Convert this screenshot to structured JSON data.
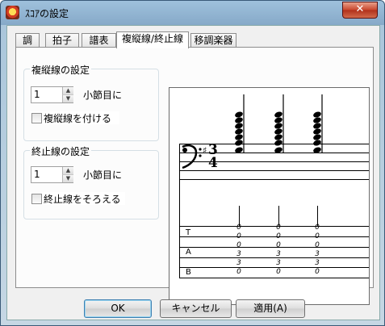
{
  "window": {
    "title": "ｽｺｱの設定",
    "close_glyph": "✕"
  },
  "tabs": [
    {
      "label": "調"
    },
    {
      "label": "拍子"
    },
    {
      "label": "譜表"
    },
    {
      "label": "複縦線/終止線",
      "active": true
    },
    {
      "label": "移調楽器"
    }
  ],
  "double_bar": {
    "group_title": "複縦線の設定",
    "measure_value": "1",
    "measure_label": "小節目に",
    "checkbox_label": "複縦線を付ける",
    "checked": false
  },
  "final_bar": {
    "group_title": "終止線の設定",
    "measure_value": "1",
    "measure_label": "小節目に",
    "checkbox_label": "終止線をそろえる",
    "checked": false
  },
  "preview": {
    "clef": "bass-clef",
    "key_signature": "♯",
    "time_signature_top": "3",
    "time_signature_bottom": "4",
    "tab_letters": [
      "T",
      "A",
      "B"
    ],
    "tab_fret_columns": [
      [
        "0",
        "0",
        "0",
        "3",
        "3",
        "0"
      ],
      [
        "0",
        "0",
        "0",
        "3",
        "3",
        "0"
      ],
      [
        "0",
        "0",
        "0",
        "3",
        "3",
        "0"
      ]
    ]
  },
  "buttons": {
    "ok": "OK",
    "cancel": "キャンセル",
    "apply": "適用(A)"
  },
  "icons": {
    "app": "app-icon",
    "spin_up": "up-arrow-icon",
    "spin_down": "down-arrow-icon"
  }
}
